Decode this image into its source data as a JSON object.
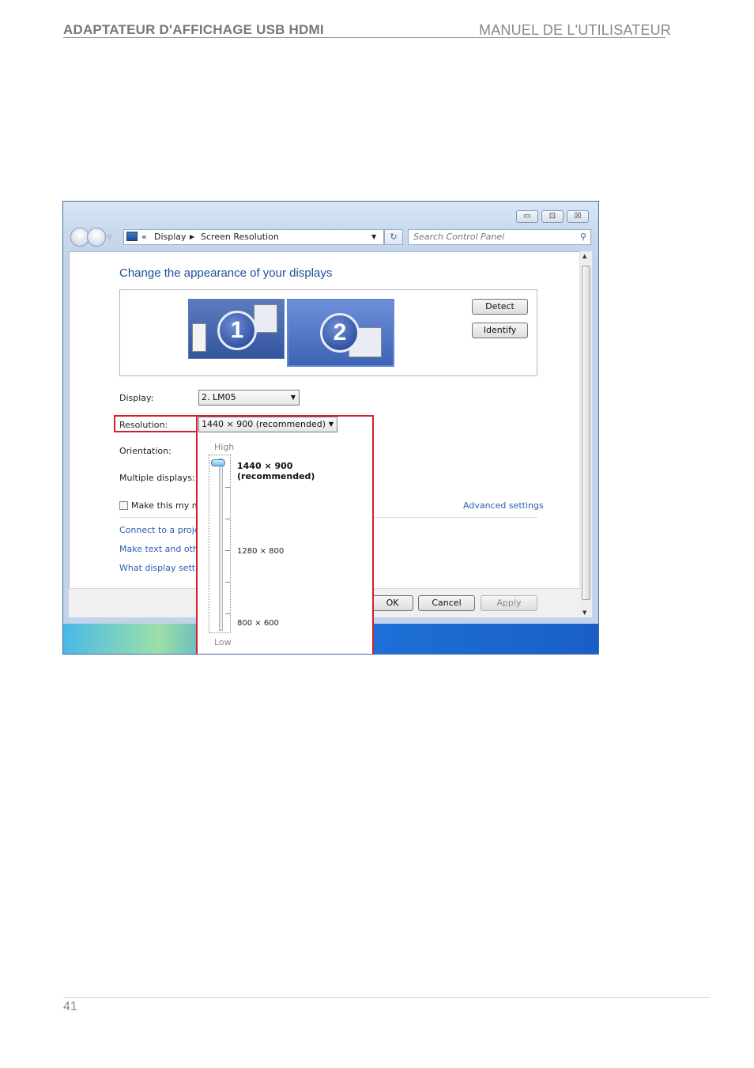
{
  "page_header": {
    "left": "ADAPTATEUR D'AFFICHAGE USB HDMI",
    "right": "MANUEL DE L'UTILISATEUR"
  },
  "page_number": "41",
  "window": {
    "controls": {
      "minimize": "▭",
      "maximize": "⊡",
      "close": "☒"
    },
    "address": {
      "chevrons": "«",
      "crumbs": [
        "Display",
        "Screen Resolution"
      ]
    },
    "search_placeholder": "Search Control Panel",
    "title": "Change the appearance of your displays",
    "monitors": [
      "1",
      "2"
    ],
    "detect_label": "Detect",
    "identify_label": "Identify",
    "display_label": "Display:",
    "display_value": "2. LM05",
    "resolution_label": "Resolution:",
    "resolution_value": "1440 × 900 (recommended)",
    "orientation_label": "Orientation:",
    "multiple_label": "Multiple displays:",
    "main_checkbox_label": "Make this my m",
    "advanced_label": "Advanced settings",
    "links": [
      "Connect to a projec",
      "Make text and othe",
      "What display settin"
    ],
    "ok_label": "OK",
    "cancel_label": "Cancel",
    "apply_label": "Apply",
    "dropdown": {
      "high_label": "High",
      "low_label": "Low",
      "options": [
        "1440 × 900 (recommended)",
        "1280 × 800",
        "800 × 600"
      ],
      "selected": "1440 × 900 (recommended)"
    }
  },
  "colors": {
    "highlight_border": "#d01f2e",
    "title_text": "#1d4f9a",
    "link_text": "#2a5db0"
  }
}
